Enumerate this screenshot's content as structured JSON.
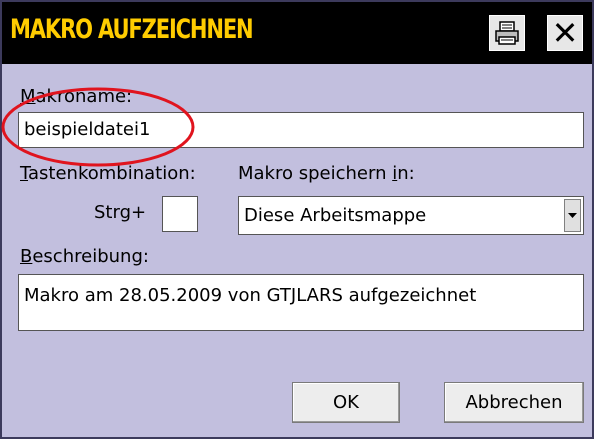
{
  "dialog": {
    "title": "MAKRO AUFZEICHNEN",
    "print_icon": "printer-icon",
    "close_icon": "close-icon",
    "close_glyph": "✕"
  },
  "form": {
    "macro_name_label_first": "M",
    "macro_name_label_rest": "akroname:",
    "macro_name_value": "beispieldatei1",
    "shortcut_label_first": "T",
    "shortcut_label_rest": "astenkombination:",
    "shortcut_prefix": "Strg+",
    "shortcut_value": "",
    "store_label_before": "Makro speichern ",
    "store_label_underlined": "i",
    "store_label_after": "n:",
    "store_selected": "Diese Arbeitsmappe",
    "description_label_first": "B",
    "description_label_rest": "eschreibung:",
    "description_value": "Makro am 28.05.2009 von GTJLARS aufgezeichnet"
  },
  "buttons": {
    "ok": "OK",
    "cancel": "Abbrechen"
  },
  "annotation": {
    "ellipse_color": "#e0141e"
  }
}
